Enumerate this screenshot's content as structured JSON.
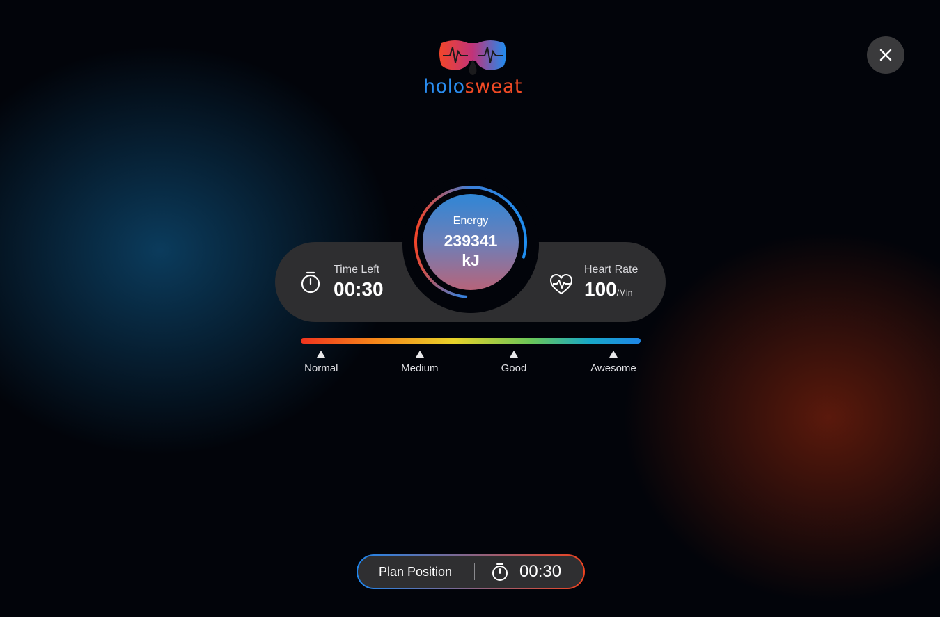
{
  "brand": {
    "word_part1": "holo",
    "word_part2": "sweat",
    "icon": "goggles-heartbeat-drop-logo"
  },
  "header": {
    "close_icon": "close-icon"
  },
  "stats": {
    "time_left": {
      "label": "Time Left",
      "value": "00:30",
      "icon": "stopwatch-icon"
    },
    "energy": {
      "label": "Energy",
      "value": "239341",
      "unit": "kJ",
      "ring_progress": 0.78
    },
    "heart_rate": {
      "label": "Heart Rate",
      "value": "100",
      "unit": "/Min",
      "icon": "heart-pulse-icon"
    }
  },
  "intensity": {
    "levels": [
      {
        "label": "Normal",
        "position": 0.06
      },
      {
        "label": "Medium",
        "position": 0.35
      },
      {
        "label": "Good",
        "position": 0.627
      },
      {
        "label": "Awesome",
        "position": 0.92
      }
    ]
  },
  "plan": {
    "label": "Plan Position",
    "time": "00:30",
    "icon": "stopwatch-icon"
  },
  "colors": {
    "brand_blue": "#2a8df0",
    "brand_red": "#f04a25",
    "card_bg": "#2e2e30",
    "background": "#02040a"
  }
}
